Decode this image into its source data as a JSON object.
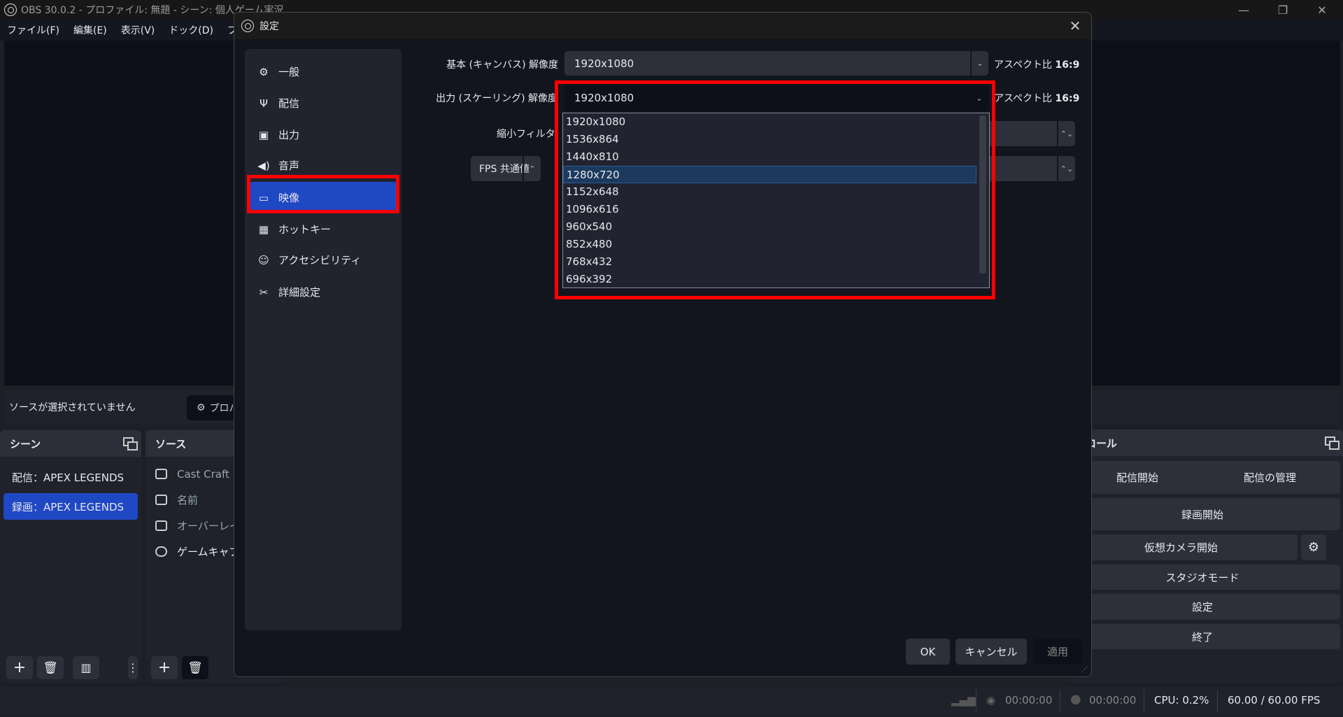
{
  "window": {
    "title": "OBS 30.0.2 - プロファイル: 無題 - シーン: 個人ゲーム実況",
    "controls": [
      "—",
      "❐",
      "✕"
    ]
  },
  "menu": [
    "ファイル(F)",
    "編集(E)",
    "表示(V)",
    "ドック(D)",
    "プロ"
  ],
  "source_bar": {
    "text": "ソースが選択されていません",
    "properties_label": "プロパ"
  },
  "scenes": {
    "title": "シーン",
    "items": [
      "配信：APEX LEGENDS",
      "録画：APEX LEGENDS"
    ],
    "selected": 1
  },
  "sources": {
    "title": "ソース",
    "items": [
      {
        "label": "Cast Craft",
        "icon": "camera-icon"
      },
      {
        "label": "名前",
        "icon": "image-icon"
      },
      {
        "label": "オーバーレイ",
        "icon": "image-icon"
      },
      {
        "label": "ゲームキャプチ",
        "icon": "gamepad-icon"
      }
    ]
  },
  "controls": {
    "title": "ントロール",
    "start_stream": "配信開始",
    "manage_stream": "配信の管理",
    "start_record": "録画開始",
    "start_vcam": "仮想カメラ開始",
    "studio_mode": "スタジオモード",
    "settings": "設定",
    "exit": "終了"
  },
  "status": {
    "stream_time": "00:00:00",
    "record_time": "00:00:00",
    "cpu": "CPU: 0.2%",
    "fps": "60.00 / 60.00 FPS"
  },
  "dialog": {
    "title": "設定",
    "nav": [
      {
        "label": "一般",
        "icon": "gear-icon"
      },
      {
        "label": "配信",
        "icon": "antenna-icon"
      },
      {
        "label": "出力",
        "icon": "output-icon"
      },
      {
        "label": "音声",
        "icon": "speaker-icon"
      },
      {
        "label": "映像",
        "icon": "monitor-icon"
      },
      {
        "label": "ホットキー",
        "icon": "keyboard-icon"
      },
      {
        "label": "アクセシビリティ",
        "icon": "accessibility-icon"
      },
      {
        "label": "詳細設定",
        "icon": "tools-icon"
      }
    ],
    "selected_nav": 4,
    "base_label": "基本 (キャンバス) 解像度",
    "base_value": "1920x1080",
    "output_label": "出力 (スケーリング) 解像度",
    "output_value": "1920x1080",
    "aspect_label": "アスペクト比",
    "aspect_base": "16:9",
    "aspect_output": "16:9",
    "filter_label": "縮小フィルタ",
    "fps_label": "FPS 共通値",
    "dropdown_options": [
      "1920x1080",
      "1536x864",
      "1440x810",
      "1280x720",
      "1152x648",
      "1096x616",
      "960x540",
      "852x480",
      "768x432",
      "696x392"
    ],
    "highlighted_option": 3,
    "ok": "OK",
    "cancel": "キャンセル",
    "apply": "適用"
  },
  "colors": {
    "accent": "#1f48c4",
    "highlight_box": "#ff0000"
  }
}
